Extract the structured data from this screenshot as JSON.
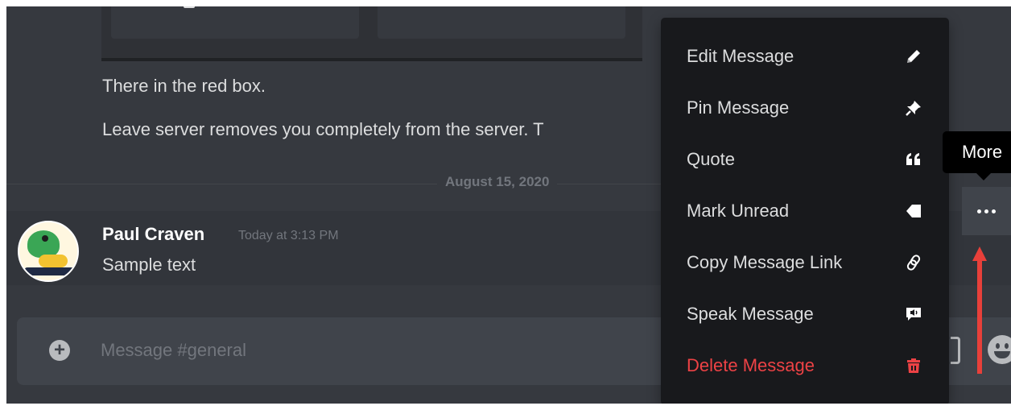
{
  "chat": {
    "previous_lines": [
      "There in the red box.",
      "Leave server removes you completely from the server. T"
    ],
    "date_divider": "August 15, 2020",
    "message": {
      "author": "Paul Craven",
      "timestamp": "Today at 3:13 PM",
      "text": "Sample text"
    }
  },
  "input": {
    "placeholder": "Message #general"
  },
  "context_menu": {
    "items": [
      {
        "label": "Edit Message",
        "icon": "pencil-icon"
      },
      {
        "label": "Pin Message",
        "icon": "pin-icon"
      },
      {
        "label": "Quote",
        "icon": "quote-icon"
      },
      {
        "label": "Mark Unread",
        "icon": "tag-icon"
      },
      {
        "label": "Copy Message Link",
        "icon": "link-icon"
      },
      {
        "label": "Speak Message",
        "icon": "speak-icon"
      },
      {
        "label": "Delete Message",
        "icon": "trash-icon",
        "danger": true
      }
    ]
  },
  "tooltip": {
    "label": "More"
  },
  "colors": {
    "background": "#36393f",
    "menu": "#18191c",
    "danger": "#ed4245",
    "annotation_arrow": "#e8403a"
  }
}
